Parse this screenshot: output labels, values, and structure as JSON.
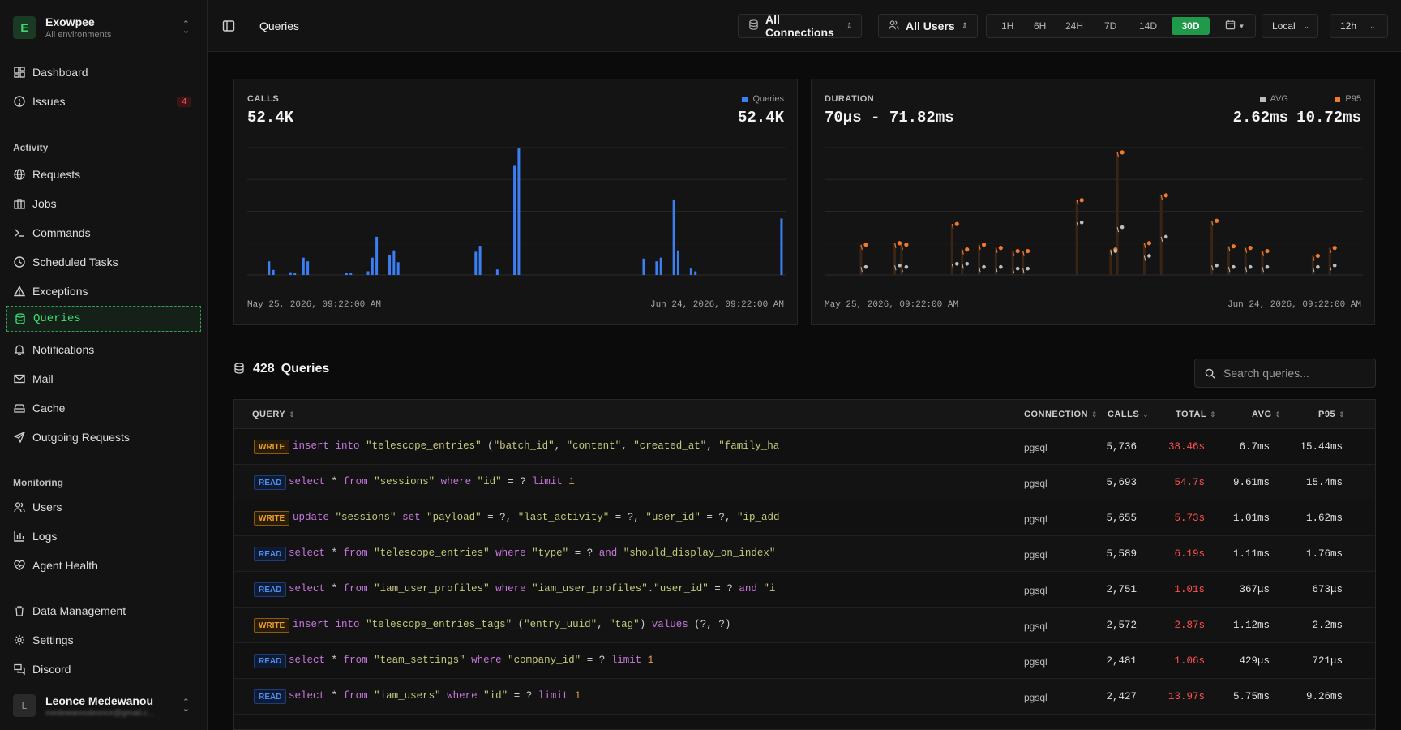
{
  "brand": {
    "initial": "E",
    "name": "Exowpee",
    "sub": "All environments"
  },
  "nav": {
    "dashboard": "Dashboard",
    "issues": "Issues",
    "issues_count": "4",
    "section_activity": "Activity",
    "requests": "Requests",
    "jobs": "Jobs",
    "commands": "Commands",
    "scheduled_tasks": "Scheduled Tasks",
    "exceptions": "Exceptions",
    "queries": "Queries",
    "notifications": "Notifications",
    "mail": "Mail",
    "cache": "Cache",
    "outgoing_requests": "Outgoing Requests",
    "section_monitoring": "Monitoring",
    "users": "Users",
    "logs": "Logs",
    "agent_health": "Agent Health",
    "data_management": "Data Management",
    "settings": "Settings",
    "discord": "Discord"
  },
  "user": {
    "initial": "L",
    "name": "Leonce Medewanou",
    "email": "medewanouleonce@gmail.c..."
  },
  "topbar": {
    "title": "Queries",
    "connections": "All Connections",
    "users": "All Users",
    "ranges": [
      "1H",
      "6H",
      "24H",
      "7D",
      "14D",
      "30D"
    ],
    "active_range": "30D",
    "timezone": "Local",
    "interval": "12h"
  },
  "calls_card": {
    "label": "CALLS",
    "value": "52.4K",
    "legend_label": "Queries",
    "legend_value": "52.4K",
    "legend_color": "#3b7ff5",
    "date_start": "May 25, 2026, 09:22:00 AM",
    "date_end": "Jun 24, 2026, 09:22:00 AM"
  },
  "duration_card": {
    "label": "DURATION",
    "value": "70μs - 71.82ms",
    "avg_label": "AVG",
    "avg_value": "2.62ms",
    "p95_label": "P95",
    "p95_value": "10.72ms",
    "avg_color": "#bdbdbd",
    "p95_color": "#f07a2a",
    "date_start": "May 25, 2026, 09:22:00 AM",
    "date_end": "Jun 24, 2026, 09:22:00 AM"
  },
  "queries": {
    "count": "428",
    "title": "Queries",
    "search_placeholder": "Search queries...",
    "columns": {
      "query": "QUERY",
      "connection": "CONNECTION",
      "calls": "CALLS",
      "total": "TOTAL",
      "avg": "AVG",
      "p95": "P95"
    },
    "rows": [
      {
        "type": "WRITE",
        "sql": "insert into \"telescope_entries\" (\"batch_id\", \"content\", \"created_at\", \"family_ha...",
        "connection": "pgsql",
        "calls": "5,736",
        "total": "38.46s",
        "avg": "6.7ms",
        "p95": "15.44ms"
      },
      {
        "type": "READ",
        "sql": "select * from \"sessions\" where \"id\" = ? limit 1",
        "connection": "pgsql",
        "calls": "5,693",
        "total": "54.7s",
        "avg": "9.61ms",
        "p95": "15.4ms"
      },
      {
        "type": "WRITE",
        "sql": "update \"sessions\" set \"payload\" = ?, \"last_activity\" = ?, \"user_id\" = ?, \"ip_add...",
        "connection": "pgsql",
        "calls": "5,655",
        "total": "5.73s",
        "avg": "1.01ms",
        "p95": "1.62ms"
      },
      {
        "type": "READ",
        "sql": "select * from \"telescope_entries\" where \"type\" = ? and \"should_display_on_index\"...",
        "connection": "pgsql",
        "calls": "5,589",
        "total": "6.19s",
        "avg": "1.11ms",
        "p95": "1.76ms"
      },
      {
        "type": "READ",
        "sql": "select * from \"iam_user_profiles\" where \"iam_user_profiles\".\"user_id\" = ? and \"i...",
        "connection": "pgsql",
        "calls": "2,751",
        "total": "1.01s",
        "avg": "367μs",
        "p95": "673μs"
      },
      {
        "type": "WRITE",
        "sql": "insert into \"telescope_entries_tags\" (\"entry_uuid\", \"tag\") values (?, ?)",
        "connection": "pgsql",
        "calls": "2,572",
        "total": "2.87s",
        "avg": "1.12ms",
        "p95": "2.2ms"
      },
      {
        "type": "READ",
        "sql": "select * from \"team_settings\" where \"company_id\" = ? limit 1",
        "connection": "pgsql",
        "calls": "2,481",
        "total": "1.06s",
        "avg": "429μs",
        "p95": "721μs"
      },
      {
        "type": "READ",
        "sql": "select * from \"iam_users\" where \"id\" = ? limit 1",
        "connection": "pgsql",
        "calls": "2,427",
        "total": "13.97s",
        "avg": "5.75ms",
        "p95": "9.26ms"
      }
    ]
  },
  "chart_data": [
    {
      "type": "bar",
      "title": "",
      "series": [
        {
          "name": "Queries",
          "color": "#3b7ff5",
          "values": [
            0,
            150,
            55,
            0,
            0,
            0,
            30,
            25,
            0,
            190,
            150,
            0,
            0,
            0,
            0,
            0,
            0,
            0,
            0,
            20,
            25,
            0,
            0,
            0,
            40,
            190,
            420,
            0,
            0,
            220,
            270,
            140,
            0,
            0,
            0,
            0,
            0,
            0,
            0,
            0,
            0,
            0,
            0,
            0,
            0,
            0,
            0,
            0,
            0,
            255,
            320,
            0,
            0,
            0,
            60,
            0,
            0,
            0,
            1200,
            1390,
            0,
            0,
            0,
            0,
            0,
            0,
            0,
            0,
            0,
            0,
            0,
            0,
            0,
            0,
            0,
            0,
            0,
            0,
            0,
            0,
            0,
            0,
            0,
            0,
            0,
            0,
            0,
            0,
            180,
            0,
            0,
            150,
            190,
            0,
            0,
            830,
            270,
            0,
            0,
            70,
            40,
            0,
            0,
            0,
            0,
            0,
            0,
            0,
            0,
            0,
            0,
            0,
            0,
            0,
            0,
            0,
            0,
            0,
            0,
            0,
            620,
            0,
            0,
            60,
            250
          ]
        }
      ],
      "ylim": [
        0,
        1400
      ],
      "grid": true,
      "xlabel": "",
      "ylabel": ""
    },
    {
      "type": "scatter",
      "title": "",
      "series": [
        {
          "name": "AVG",
          "color": "#bdbdbd",
          "points": [
            {
              "x": 6,
              "y": 0.5
            },
            {
              "x": 16,
              "y": 0.6
            },
            {
              "x": 18,
              "y": 0.5
            },
            {
              "x": 33,
              "y": 0.7
            },
            {
              "x": 36,
              "y": 0.7
            },
            {
              "x": 41,
              "y": 0.5
            },
            {
              "x": 46,
              "y": 0.5
            },
            {
              "x": 51,
              "y": 0.4
            },
            {
              "x": 54,
              "y": 0.4
            },
            {
              "x": 70,
              "y": 3.3
            },
            {
              "x": 80,
              "y": 1.5
            },
            {
              "x": 82,
              "y": 3.0
            },
            {
              "x": 90,
              "y": 1.2
            },
            {
              "x": 95,
              "y": 2.4
            },
            {
              "x": 110,
              "y": 0.6
            },
            {
              "x": 115,
              "y": 0.5
            },
            {
              "x": 120,
              "y": 0.5
            },
            {
              "x": 125,
              "y": 0.5
            },
            {
              "x": 140,
              "y": 0.5
            },
            {
              "x": 145,
              "y": 0.6
            }
          ]
        },
        {
          "name": "P95",
          "color": "#f07a2a",
          "points": [
            {
              "x": 6,
              "y": 1.9
            },
            {
              "x": 16,
              "y": 2.0
            },
            {
              "x": 18,
              "y": 1.9
            },
            {
              "x": 33,
              "y": 3.2
            },
            {
              "x": 36,
              "y": 1.6
            },
            {
              "x": 41,
              "y": 1.9
            },
            {
              "x": 46,
              "y": 1.7
            },
            {
              "x": 51,
              "y": 1.5
            },
            {
              "x": 54,
              "y": 1.5
            },
            {
              "x": 70,
              "y": 4.7
            },
            {
              "x": 80,
              "y": 1.6
            },
            {
              "x": 82,
              "y": 7.7
            },
            {
              "x": 90,
              "y": 2.0
            },
            {
              "x": 95,
              "y": 5.0
            },
            {
              "x": 110,
              "y": 3.4
            },
            {
              "x": 115,
              "y": 1.8
            },
            {
              "x": 120,
              "y": 1.7
            },
            {
              "x": 125,
              "y": 1.5
            },
            {
              "x": 140,
              "y": 1.2
            },
            {
              "x": 145,
              "y": 1.7
            }
          ]
        }
      ],
      "ylim": [
        0,
        8
      ],
      "grid": true,
      "xlabel": "",
      "ylabel": ""
    }
  ]
}
